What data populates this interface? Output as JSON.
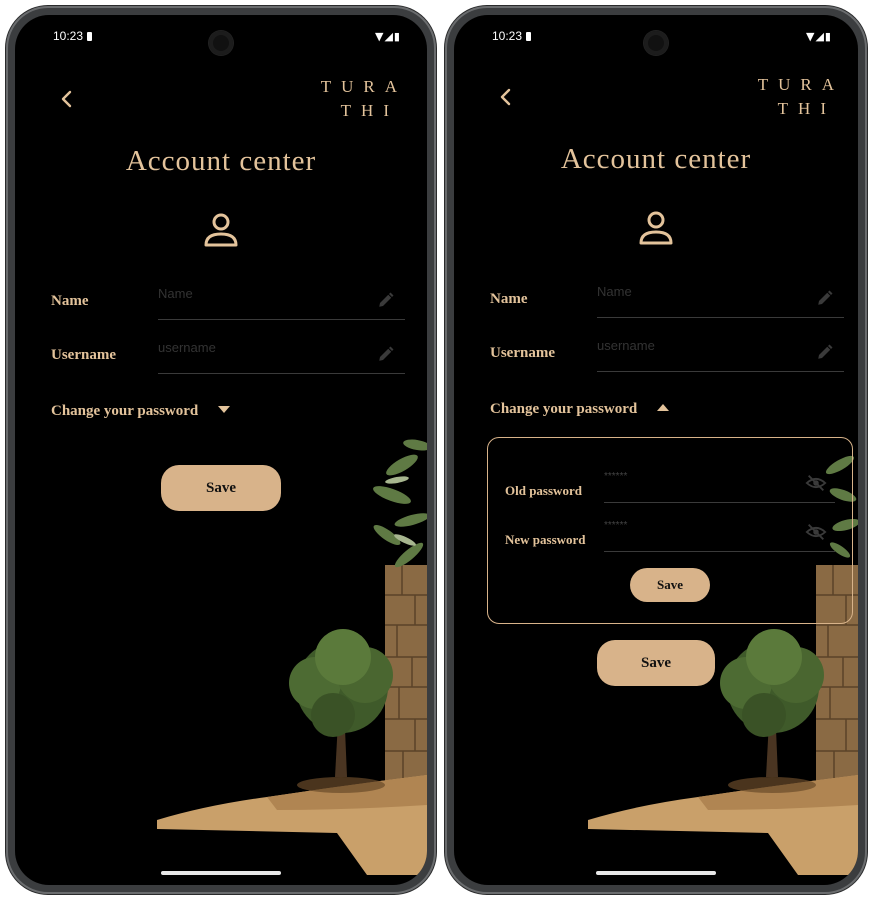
{
  "status_bar": {
    "time": "10:23",
    "icons": "▼◢▮"
  },
  "brand": {
    "line1": "TURA",
    "line2": "THI"
  },
  "screen": {
    "title": "Account center"
  },
  "form": {
    "name_label": "Name",
    "name_placeholder": "Name",
    "username_label": "Username",
    "username_placeholder": "username",
    "change_password_label": "Change your password",
    "save_label": "Save"
  },
  "password_panel": {
    "old_password_label": "Old password",
    "old_password_placeholder": "******",
    "new_password_label": "New password",
    "new_password_placeholder": "******",
    "save_label": "Save"
  },
  "screens": [
    {
      "state": "password section collapsed",
      "arrow": "down"
    },
    {
      "state": "password section expanded",
      "arrow": "up"
    }
  ],
  "colors": {
    "background": "#000000",
    "accent": "#e3c39b",
    "button": "#d8b38a"
  },
  "icons": [
    "back-chevron-icon",
    "user-icon",
    "edit-pencil-icon",
    "eye-off-icon",
    "dropdown-arrow-icon"
  ]
}
